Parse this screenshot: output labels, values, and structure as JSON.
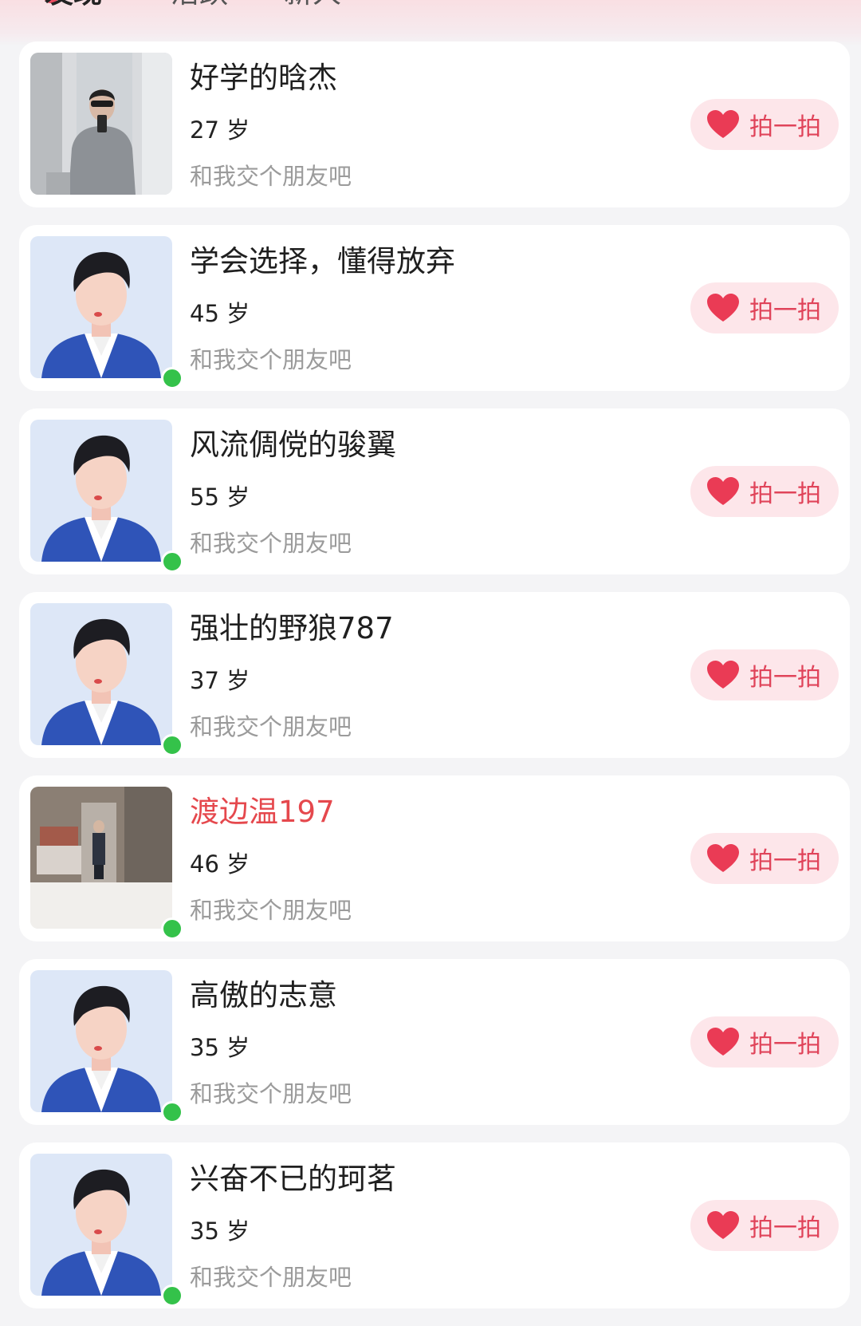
{
  "header": {
    "tabs": [
      {
        "label": "发现"
      },
      {
        "label": "活跃"
      },
      {
        "label": "新人"
      }
    ]
  },
  "users": [
    {
      "name": "好学的晗杰",
      "age": "27 岁",
      "greeting": "和我交个朋友吧",
      "button": "拍一拍",
      "avatar": "photo-selfie",
      "online": false,
      "name_color": "#1f1f1f"
    },
    {
      "name": "学会选择，懂得放弃",
      "age": "45 岁",
      "greeting": "和我交个朋友吧",
      "button": "拍一拍",
      "avatar": "default-male",
      "online": true,
      "name_color": "#1f1f1f"
    },
    {
      "name": "风流倜傥的骏翼",
      "age": "55 岁",
      "greeting": "和我交个朋友吧",
      "button": "拍一拍",
      "avatar": "default-male",
      "online": true,
      "name_color": "#1f1f1f"
    },
    {
      "name": "强壮的野狼787",
      "age": "37 岁",
      "greeting": "和我交个朋友吧",
      "button": "拍一拍",
      "avatar": "default-male",
      "online": true,
      "name_color": "#1f1f1f"
    },
    {
      "name": "渡边温197",
      "age": "46 岁",
      "greeting": "和我交个朋友吧",
      "button": "拍一拍",
      "avatar": "photo-room",
      "online": true,
      "name_color": "#e5484d"
    },
    {
      "name": "高傲的志意",
      "age": "35 岁",
      "greeting": "和我交个朋友吧",
      "button": "拍一拍",
      "avatar": "default-male",
      "online": true,
      "name_color": "#1f1f1f"
    },
    {
      "name": "兴奋不已的珂茗",
      "age": "35 岁",
      "greeting": "和我交个朋友吧",
      "button": "拍一拍",
      "avatar": "default-male",
      "online": true,
      "name_color": "#1f1f1f"
    }
  ],
  "colors": {
    "accent": "#e0445a",
    "button_bg": "#fde6ea",
    "online": "#34c24a"
  }
}
